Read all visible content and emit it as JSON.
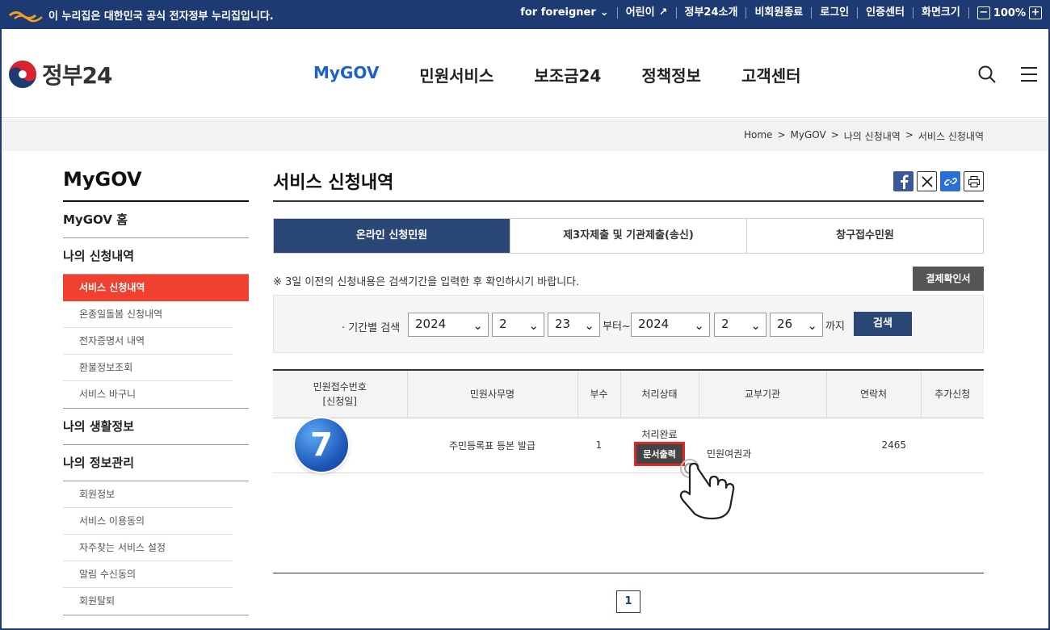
{
  "topbar": {
    "notice": "이 누리집은 대한민국 공식 전자정부 누리집입니다.",
    "links": [
      "for foreigner",
      "어린이",
      "정부24소개",
      "비회원종료",
      "로그인",
      "인증센터",
      "화면크기"
    ],
    "zoom": "100%",
    "zoom_minus": "−",
    "zoom_plus": "+"
  },
  "header": {
    "logo_text": "정부24",
    "nav": [
      "MyGOV",
      "민원서비스",
      "보조금24",
      "정책정보",
      "고객센터"
    ]
  },
  "breadcrumb": [
    "Home",
    "MyGOV",
    "나의 신청내역",
    "서비스 신청내역"
  ],
  "breadcrumb_sep": ">",
  "sidebar": {
    "title": "MyGOV",
    "home": "MyGOV 홈",
    "apply": "나의 신청내역",
    "apply_items": [
      "서비스 신청내역",
      "온종일돌봄 신청내역",
      "전자증명서 내역",
      "환불정보조회",
      "서비스 바구니"
    ],
    "life": "나의 생활정보",
    "info": "나의 정보관리",
    "info_items": [
      "회원정보",
      "서비스 이용동의",
      "자주찾는 서비스 설정",
      "알림 수신동의",
      "회원탈퇴"
    ]
  },
  "main": {
    "title": "서비스 신청내역",
    "tabs": [
      "온라인 신청민원",
      "제3자제출 및 기관제출(송신)",
      "창구접수민원"
    ],
    "notice": "※ 3일 이전의 신청내용은 검색기간을 입력한 후 확인하시기 바랍니다.",
    "cert_button": "결제확인서",
    "search": {
      "label": "· 기간별 검색",
      "from_year": "2024",
      "from_month": "2",
      "from_day": "23",
      "from_text": "부터~",
      "to_year": "2024",
      "to_month": "2",
      "to_day": "26",
      "to_text": "까지",
      "button": "검색"
    },
    "table": {
      "headers": [
        "민원접수번호",
        "[신청일]",
        "민원사무명",
        "부수",
        "처리상태",
        "교부기관",
        "연락처",
        "추가신청"
      ],
      "row": {
        "name": "주민등록표 등본 발급",
        "copies": "1",
        "status": "처리완료",
        "print_button": "문서출력",
        "agency": "민원여권과",
        "contact": "2465"
      }
    },
    "page": "1"
  },
  "step_badge": "7"
}
